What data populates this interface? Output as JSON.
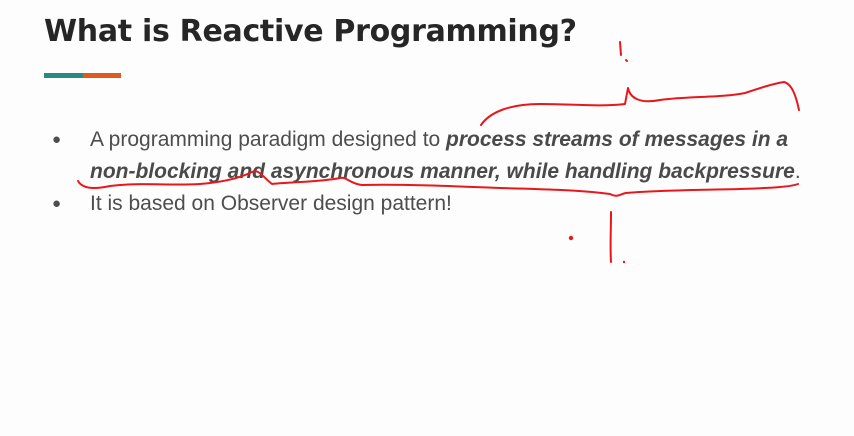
{
  "slide": {
    "title": "What is Reactive Programming?",
    "accent_colors": [
      "#2b8a7e",
      "#e0591f"
    ],
    "bullets": [
      {
        "pre": "A programming paradigm designed to ",
        "emphasis": "process streams of messages in a non-blocking and asynchronous manner, while handling backpressure",
        "post": "."
      },
      {
        "text": "It is based on Observer design pattern!"
      }
    ],
    "bullet_glyph": "●",
    "annotation_color": "#e8171c"
  }
}
